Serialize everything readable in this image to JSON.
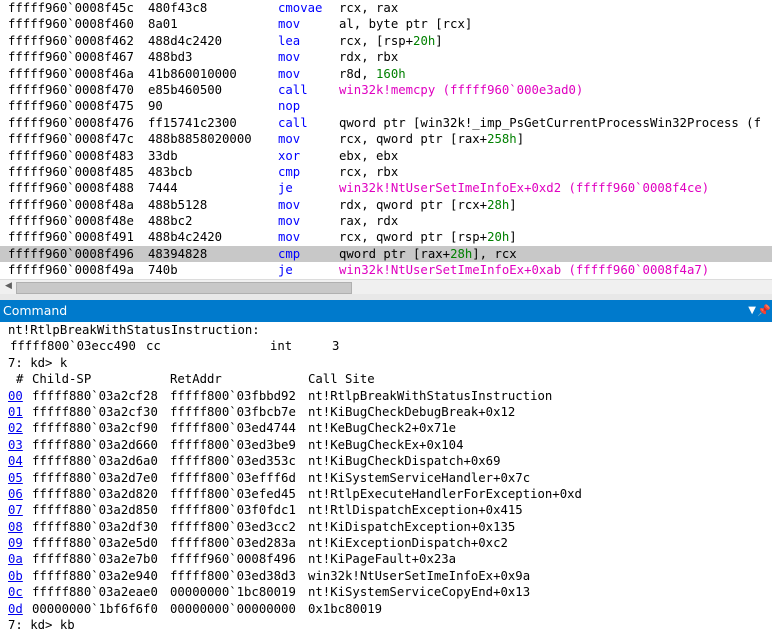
{
  "disasm": {
    "lines": [
      {
        "addr": "fffff960`0008f45c",
        "bytes": "480f43c8",
        "mnem": "cmovae",
        "ops": "rcx, rax",
        "style": "plain"
      },
      {
        "addr": "fffff960`0008f460",
        "bytes": "8a01",
        "mnem": "mov",
        "ops": "al, byte ptr [rcx]",
        "style": "plain"
      },
      {
        "addr": "fffff960`0008f462",
        "bytes": "488d4c2420",
        "mnem": "lea",
        "ops": "rcx, [rsp+20h]",
        "style": "plain"
      },
      {
        "addr": "fffff960`0008f467",
        "bytes": "488bd3",
        "mnem": "mov",
        "ops": "rdx, rbx",
        "style": "plain"
      },
      {
        "addr": "fffff960`0008f46a",
        "bytes": "41b860010000",
        "mnem": "mov",
        "ops": "r8d, 160h",
        "style": "plain"
      },
      {
        "addr": "fffff960`0008f470",
        "bytes": "e85b460500",
        "mnem": "call",
        "ops": "win32k!memcpy (fffff960`000e3ad0)",
        "style": "pink"
      },
      {
        "addr": "fffff960`0008f475",
        "bytes": "90",
        "mnem": "nop",
        "ops": "",
        "style": "plain"
      },
      {
        "addr": "fffff960`0008f476",
        "bytes": "ff15741c2300",
        "mnem": "call",
        "ops": "qword ptr [win32k!_imp_PsGetCurrentProcessWin32Process (f",
        "style": "plain"
      },
      {
        "addr": "fffff960`0008f47c",
        "bytes": "488b8858020000",
        "mnem": "mov",
        "ops": "rcx, qword ptr [rax+258h]",
        "style": "plain"
      },
      {
        "addr": "fffff960`0008f483",
        "bytes": "33db",
        "mnem": "xor",
        "ops": "ebx, ebx",
        "style": "plain"
      },
      {
        "addr": "fffff960`0008f485",
        "bytes": "483bcb",
        "mnem": "cmp",
        "ops": "rcx, rbx",
        "style": "plain"
      },
      {
        "addr": "fffff960`0008f488",
        "bytes": "7444",
        "mnem": "je",
        "ops": "win32k!NtUserSetImeInfoEx+0xd2 (fffff960`0008f4ce)",
        "style": "pink"
      },
      {
        "addr": "fffff960`0008f48a",
        "bytes": "488b5128",
        "mnem": "mov",
        "ops": "rdx, qword ptr [rcx+28h]",
        "style": "plain"
      },
      {
        "addr": "fffff960`0008f48e",
        "bytes": "488bc2",
        "mnem": "mov",
        "ops": "rax, rdx",
        "style": "plain"
      },
      {
        "addr": "fffff960`0008f491",
        "bytes": "488b4c2420",
        "mnem": "mov",
        "ops": "rcx, qword ptr [rsp+20h]",
        "style": "plain"
      },
      {
        "addr": "fffff960`0008f496",
        "bytes": "48394828",
        "mnem": "cmp",
        "ops": "qword ptr [rax+28h], rcx",
        "style": "plain",
        "highlight": true
      },
      {
        "addr": "fffff960`0008f49a",
        "bytes": "740b",
        "mnem": "je",
        "ops": "win32k!NtUserSetImeInfoEx+0xab (fffff960`0008f4a7)",
        "style": "pink"
      }
    ]
  },
  "scroll_left_icon": "triangle-left",
  "command_window": {
    "title": "Command",
    "dropdown_icon": "triangle-down",
    "pin_icon": "pin",
    "breakpoint_label": "nt!RtlpBreakWithStatusInstruction:",
    "breakpoint_line": {
      "addr": "fffff800`03ecc490",
      "bytes": "cc",
      "mnem": "int",
      "op": "3"
    },
    "prompt_line": "7: kd> k",
    "stack_header": {
      "num": "#",
      "child_sp": "Child-SP",
      "ret_addr": "RetAddr",
      "call_site": "Call Site"
    },
    "frames": [
      {
        "idx": "00",
        "child_sp": "fffff880`03a2cf28",
        "ret_addr": "fffff800`03fbbd92",
        "call_site": "nt!RtlpBreakWithStatusInstruction"
      },
      {
        "idx": "01",
        "child_sp": "fffff880`03a2cf30",
        "ret_addr": "fffff800`03fbcb7e",
        "call_site": "nt!KiBugCheckDebugBreak+0x12"
      },
      {
        "idx": "02",
        "child_sp": "fffff880`03a2cf90",
        "ret_addr": "fffff800`03ed4744",
        "call_site": "nt!KeBugCheck2+0x71e"
      },
      {
        "idx": "03",
        "child_sp": "fffff880`03a2d660",
        "ret_addr": "fffff800`03ed3be9",
        "call_site": "nt!KeBugCheckEx+0x104"
      },
      {
        "idx": "04",
        "child_sp": "fffff880`03a2d6a0",
        "ret_addr": "fffff800`03ed353c",
        "call_site": "nt!KiBugCheckDispatch+0x69"
      },
      {
        "idx": "05",
        "child_sp": "fffff880`03a2d7e0",
        "ret_addr": "fffff800`03efff6d",
        "call_site": "nt!KiSystemServiceHandler+0x7c"
      },
      {
        "idx": "06",
        "child_sp": "fffff880`03a2d820",
        "ret_addr": "fffff800`03efed45",
        "call_site": "nt!RtlpExecuteHandlerForException+0xd"
      },
      {
        "idx": "07",
        "child_sp": "fffff880`03a2d850",
        "ret_addr": "fffff800`03f0fdc1",
        "call_site": "nt!RtlDispatchException+0x415"
      },
      {
        "idx": "08",
        "child_sp": "fffff880`03a2df30",
        "ret_addr": "fffff800`03ed3cc2",
        "call_site": "nt!KiDispatchException+0x135"
      },
      {
        "idx": "09",
        "child_sp": "fffff880`03a2e5d0",
        "ret_addr": "fffff800`03ed283a",
        "call_site": "nt!KiExceptionDispatch+0xc2"
      },
      {
        "idx": "0a",
        "child_sp": "fffff880`03a2e7b0",
        "ret_addr": "fffff960`0008f496",
        "call_site": "nt!KiPageFault+0x23a"
      },
      {
        "idx": "0b",
        "child_sp": "fffff880`03a2e940",
        "ret_addr": "fffff800`03ed38d3",
        "call_site": "win32k!NtUserSetImeInfoEx+0x9a"
      },
      {
        "idx": "0c",
        "child_sp": "fffff880`03a2eae0",
        "ret_addr": "00000000`1bc80019",
        "call_site": "nt!KiSystemServiceCopyEnd+0x13"
      },
      {
        "idx": "0d",
        "child_sp": "00000000`1bf6f6f0",
        "ret_addr": "00000000`00000000",
        "call_site": "0x1bc80019"
      }
    ],
    "last_prompt": "7: kd> kb"
  }
}
